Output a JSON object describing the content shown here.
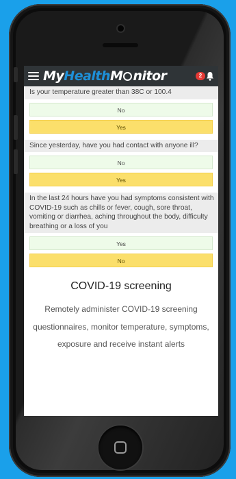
{
  "app": {
    "logo_my": "My",
    "logo_health": "Health",
    "logo_m": "M",
    "logo_nitor": "nitor",
    "notification_count": "2"
  },
  "questions": [
    {
      "text": "Is your temperature greater than 38C or 100.4",
      "options": [
        {
          "label": "No",
          "color": "#eefbe9"
        },
        {
          "label": "Yes",
          "color": "#fbdf6b"
        }
      ]
    },
    {
      "text": "Since yesterday, have you had contact with anyone ill?",
      "options": [
        {
          "label": "No",
          "color": "#eefbe9"
        },
        {
          "label": "Yes",
          "color": "#fbdf6b"
        }
      ]
    },
    {
      "text": "In the last 24 hours have you had symptoms consistent with COVID-19 such as chills or fever, cough, sore throat, vomiting or diarrhea, aching throughout the body, difficulty breathing or a loss of you",
      "options": [
        {
          "label": "Yes",
          "color": "#eefbe9"
        },
        {
          "label": "No",
          "color": "#fbdf6b"
        }
      ]
    }
  ],
  "feature": {
    "title": "COVID-19 screening",
    "description": "Remotely administer COVID-19 screening questionnaires, monitor temperature, symptoms, exposure and receive instant alerts"
  },
  "colors": {
    "background": "#1aa0ea",
    "header": "#2f3437",
    "brand_blue": "#1e90d8",
    "badge": "#e53935"
  }
}
